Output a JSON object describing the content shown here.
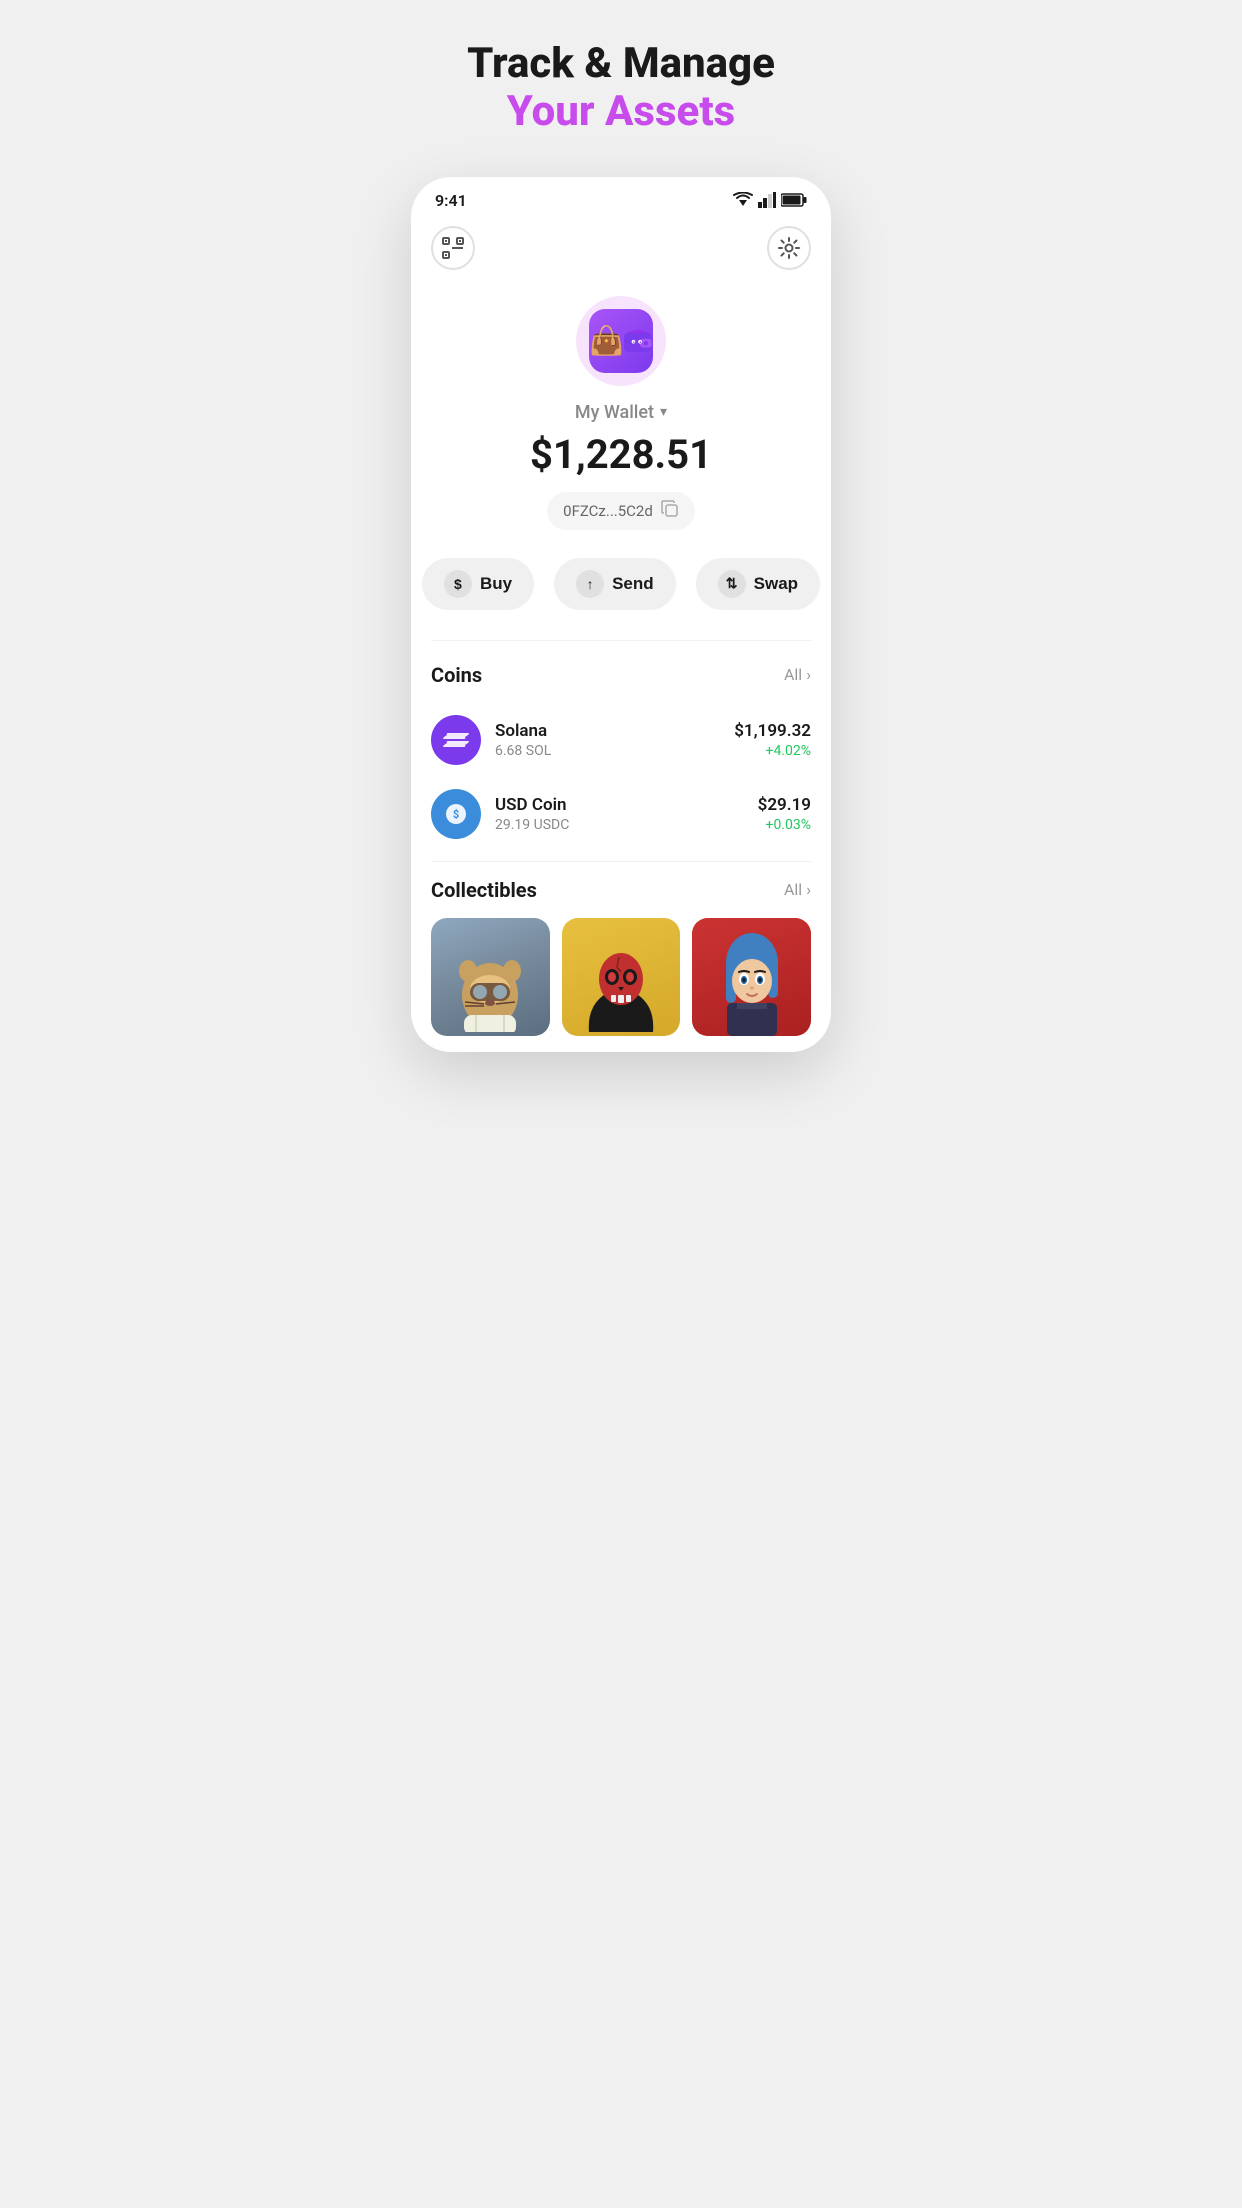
{
  "hero": {
    "title_line1": "Track & Manage",
    "title_line2": "Your Assets"
  },
  "status_bar": {
    "time": "9:41"
  },
  "header": {
    "scan_label": "Scan",
    "settings_label": "Settings"
  },
  "wallet": {
    "name": "My Wallet",
    "balance": "$1,228.51",
    "address": "0FZCz...5C2d",
    "chevron": "▾"
  },
  "actions": {
    "buy_label": "Buy",
    "send_label": "Send",
    "swap_label": "Swap"
  },
  "coins": {
    "section_title": "Coins",
    "all_label": "All",
    "items": [
      {
        "name": "Solana",
        "amount": "6.68 SOL",
        "price": "$1,199.32",
        "change": "+4.02%",
        "symbol": "S"
      },
      {
        "name": "USD Coin",
        "amount": "29.19 USDC",
        "price": "$29.19",
        "change": "+0.03%",
        "symbol": "$"
      }
    ]
  },
  "collectibles": {
    "section_title": "Collectibles",
    "all_label": "All",
    "items": [
      {
        "emoji": "🐯",
        "bg": "muted-blue"
      },
      {
        "emoji": "💀",
        "bg": "yellow"
      },
      {
        "emoji": "👩",
        "bg": "red"
      }
    ]
  }
}
